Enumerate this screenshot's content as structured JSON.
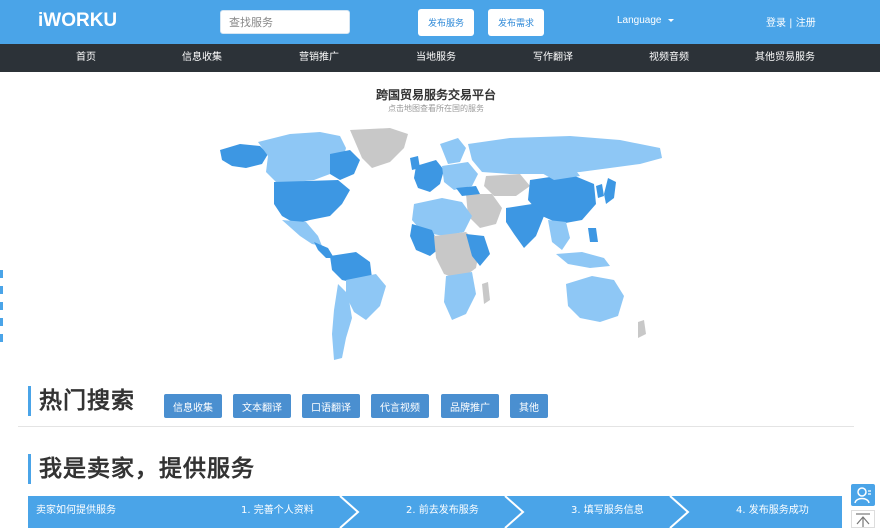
{
  "header": {
    "logo": "iWORKU",
    "search_placeholder": "查找服务",
    "publish_service": "发布服务",
    "publish_demand": "发布需求",
    "language": "Language",
    "login": "登录 | 注册"
  },
  "nav": {
    "items": [
      "首页",
      "信息收集",
      "营销推广",
      "当地服务",
      "写作翻译",
      "视频音频",
      "其他贸易服务"
    ]
  },
  "map_section": {
    "title": "跨国贸易服务交易平台",
    "subtitle": "点击地图查看所在国的服务"
  },
  "hot_search": {
    "title": "热门搜索",
    "tags": [
      "信息收集",
      "文本翻译",
      "口语翻译",
      "代言视频",
      "品牌推广",
      "其他"
    ]
  },
  "seller": {
    "title": "我是卖家，提供服务",
    "steps": [
      "卖家如何提供服务",
      "1. 完善个人资料",
      "2. 前去发布服务",
      "3. 填写服务信息",
      "4. 发布服务成功"
    ]
  },
  "colors": {
    "brand": "#4aa4e8",
    "nav_bg": "#2c3238",
    "tag_bg": "#4a8fd0",
    "map_dark": "#3d97e3",
    "map_light": "#8ec7f5",
    "map_grey": "#c8c8c8"
  },
  "icons": {
    "float_user": "user-service-icon",
    "float_top": "back-to-top-icon"
  }
}
